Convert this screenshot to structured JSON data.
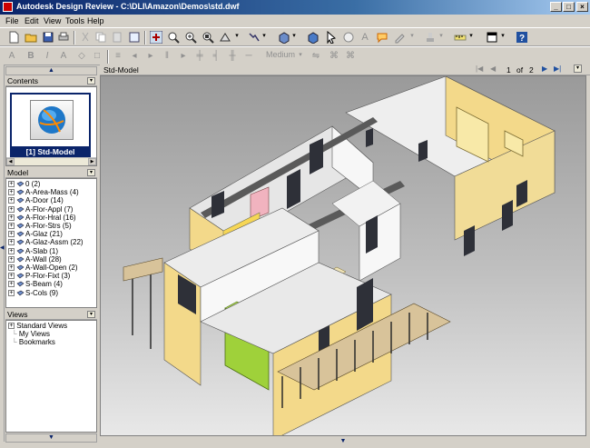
{
  "window": {
    "title": "Autodesk Design Review - C:\\DLI\\Amazon\\Demos\\std.dwf"
  },
  "menu": [
    "File",
    "Edit",
    "View",
    "Tools",
    "Help"
  ],
  "toolbar2": {
    "line_weight": "Medium"
  },
  "panels": {
    "contents": {
      "header": "Contents",
      "sheet_label": "[1] Std-Model"
    },
    "model": {
      "header": "Model",
      "layers": [
        "0 (2)",
        "A-Area-Mass (4)",
        "A-Door (14)",
        "A-Flor-Appl (7)",
        "A-Flor-Hral (16)",
        "A-Flor-Strs (5)",
        "A-Glaz (21)",
        "A-Glaz-Assm (22)",
        "A-Slab (1)",
        "A-Wall (28)",
        "A-Wall-Open (2)",
        "P-Flor-Fixt (3)",
        "S-Beam (4)",
        "S-Cols (9)"
      ]
    },
    "views": {
      "header": "Views",
      "items": [
        "Standard Views",
        "My Views",
        "Bookmarks"
      ]
    }
  },
  "canvas": {
    "sheet_name": "Std-Model",
    "page_current": "1",
    "page_of": "of",
    "page_total": "2"
  },
  "colors": {
    "titlebar": "#0a246a",
    "wall_yellow": "#f0d890",
    "green_box": "#9fd13a",
    "floor": "#e6e6e6"
  }
}
